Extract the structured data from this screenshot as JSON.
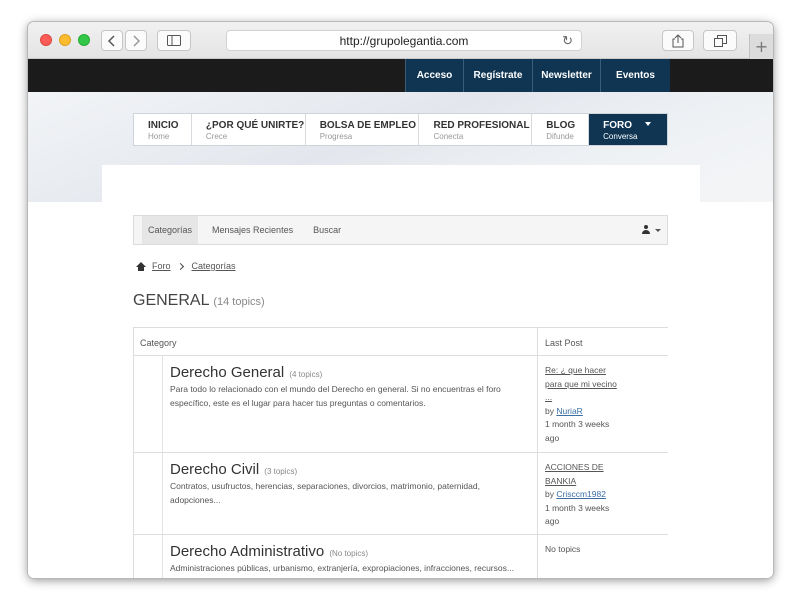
{
  "browser": {
    "url": "http://grupolegantia.com",
    "new_tab": "+"
  },
  "topnav": [
    "Acceso",
    "Regístrate",
    "Newsletter",
    "Eventos"
  ],
  "mainnav": [
    {
      "title": "INICIO",
      "sub": "Home"
    },
    {
      "title": "¿POR QUÉ UNIRTE?",
      "sub": "Crece"
    },
    {
      "title": "BOLSA DE EMPLEO",
      "sub": "Progresa"
    },
    {
      "title": "RED PROFESIONAL",
      "sub": "Conecta"
    },
    {
      "title": "BLOG",
      "sub": "Difunde"
    },
    {
      "title": "FORO",
      "sub": "Conversa"
    }
  ],
  "forum_tabs": [
    "Categorías",
    "Mensajes Recientes",
    "Buscar"
  ],
  "breadcrumb": [
    "Foro",
    "Categorías"
  ],
  "page_title": "GENERAL",
  "page_count": "(14 topics)",
  "table": {
    "col_category": "Category",
    "col_last": "Last Post",
    "rows": [
      {
        "name": "Derecho General",
        "count": "(4 topics)",
        "desc": "Para todo lo relacionado con el mundo del Derecho en general. Si no encuentras el foro específico, este es el lugar para hacer tus preguntas o comentarios.",
        "last_title": "Re: ¿ que hacer para que mi vecino ...",
        "last_by": "by",
        "last_author": "NuriaR",
        "last_time": "1 month 3 weeks ago"
      },
      {
        "name": "Derecho Civil",
        "count": "(3 topics)",
        "desc": "Contratos, usufructos, herencias, separaciones, divorcios, matrimonio, paternidad, adopciones...",
        "last_title": "ACCIONES DE BANKIA",
        "last_by": "by",
        "last_author": "Crisccm1982",
        "last_time": "1 month 3 weeks ago"
      },
      {
        "name": "Derecho Administrativo",
        "count": "(No topics)",
        "desc": "Administraciones públicas, urbanismo, extranjería, expropiaciones, infracciones, recursos...",
        "last_none": "No topics"
      }
    ]
  }
}
